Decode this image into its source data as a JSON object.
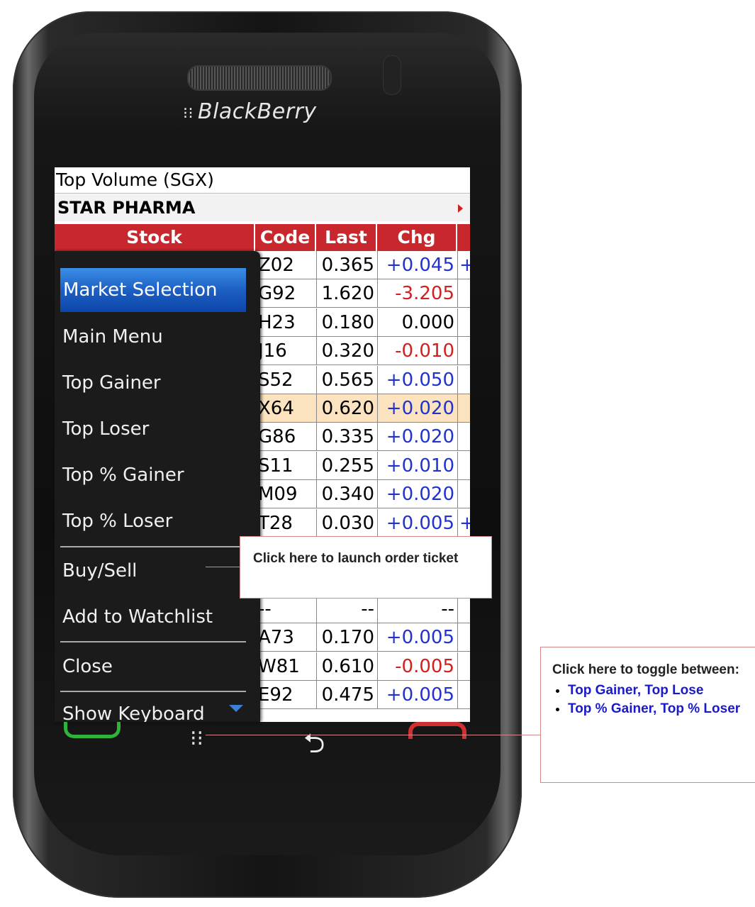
{
  "device": {
    "brand": "BlackBerry"
  },
  "screen": {
    "title": "Top Volume (SGX)",
    "selected_stock": "STAR PHARMA",
    "columns": [
      "Stock",
      "Code",
      "Last",
      "Chg"
    ],
    "rows": [
      {
        "code": "Z02",
        "last": "0.365",
        "chg": "+0.045",
        "ext": "+"
      },
      {
        "code": "G92",
        "last": "1.620",
        "chg": "-3.205",
        "ext": ""
      },
      {
        "code": "H23",
        "last": "0.180",
        "chg": "0.000",
        "ext": ""
      },
      {
        "code": "J16",
        "last": "0.320",
        "chg": "-0.010",
        "ext": ""
      },
      {
        "code": "S52",
        "last": "0.565",
        "chg": "+0.050",
        "ext": ""
      },
      {
        "code": "X64",
        "last": "0.620",
        "chg": "+0.020",
        "ext": ""
      },
      {
        "code": "G86",
        "last": "0.335",
        "chg": "+0.020",
        "ext": ""
      },
      {
        "code": "S11",
        "last": "0.255",
        "chg": "+0.010",
        "ext": ""
      },
      {
        "code": "M09",
        "last": "0.340",
        "chg": "+0.020",
        "ext": ""
      },
      {
        "code": "T28",
        "last": "0.030",
        "chg": "+0.005",
        "ext": "+"
      },
      {
        "code": "",
        "last": "",
        "chg": "",
        "ext": ""
      },
      {
        "code": "",
        "last": "",
        "chg": "",
        "ext": ""
      },
      {
        "code": "--",
        "last": "--",
        "chg": "--",
        "ext": ""
      },
      {
        "code": "A73",
        "last": "0.170",
        "chg": "+0.005",
        "ext": ""
      },
      {
        "code": "W81",
        "last": "0.610",
        "chg": "-0.005",
        "ext": ""
      },
      {
        "code": "E92",
        "last": "0.475",
        "chg": "+0.005",
        "ext": ""
      }
    ]
  },
  "menu": {
    "items": [
      "Market Selection",
      "Main Menu",
      "Top Gainer",
      "Top Loser",
      "Top % Gainer",
      "Top % Loser",
      "Buy/Sell",
      "Add to Watchlist",
      "Close",
      "Show Keyboard"
    ],
    "selected": "Market Selection"
  },
  "callouts": {
    "order_ticket": "Click here to launch order ticket",
    "toggle_title": "Click here to toggle between:",
    "toggle_items": [
      "Top Gainer, Top Lose",
      "Top % Gainer, Top % Loser"
    ]
  },
  "colors": {
    "header_red": "#c8282d",
    "positive": "#2233cc",
    "negative": "#d02020",
    "highlight_row": "#fbe3bf",
    "menu_selected": "#1d5fc4"
  },
  "icons": [
    "call-icon",
    "blackberry-menu-icon",
    "back-icon",
    "end-call-icon",
    "chevron-down-icon"
  ]
}
